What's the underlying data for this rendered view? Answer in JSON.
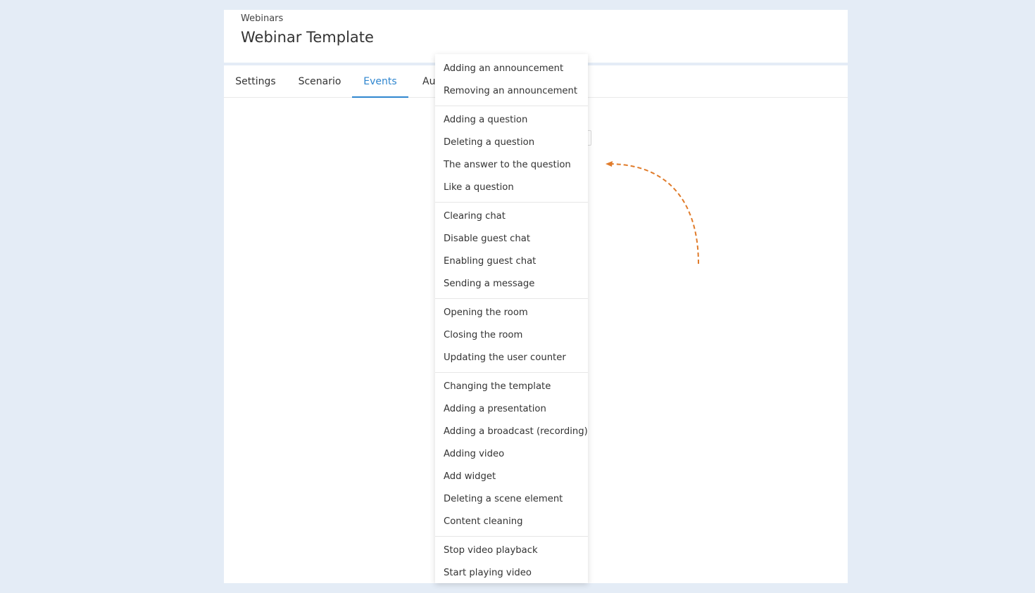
{
  "header": {
    "breadcrumb": "Webinars",
    "title": "Webinar Template"
  },
  "tabs": [
    {
      "label": "Settings"
    },
    {
      "label": "Scenario"
    },
    {
      "label": "Events"
    },
    {
      "label": "Au"
    }
  ],
  "active_tab": "Events",
  "dropdown": {
    "groups": [
      [
        "Adding an announcement",
        "Removing an announcement"
      ],
      [
        "Adding a question",
        "Deleting a question",
        "The answer to the question",
        "Like a question"
      ],
      [
        "Clearing chat",
        "Disable guest chat",
        "Enabling guest chat",
        "Sending a message"
      ],
      [
        "Opening the room",
        "Closing the room",
        "Updating the user counter"
      ],
      [
        "Changing the template",
        "Adding a presentation",
        "Adding a broadcast (recording)",
        "Adding video",
        "Add widget",
        "Deleting a scene element",
        "Content cleaning"
      ],
      [
        "Stop video playback",
        "Start playing video"
      ]
    ]
  },
  "colors": {
    "accent": "#2f86cf",
    "arrow": "#e07b2a",
    "background": "#e4ecf6"
  },
  "icons": {
    "annotation": "curved-dashed-arrow-icon"
  }
}
